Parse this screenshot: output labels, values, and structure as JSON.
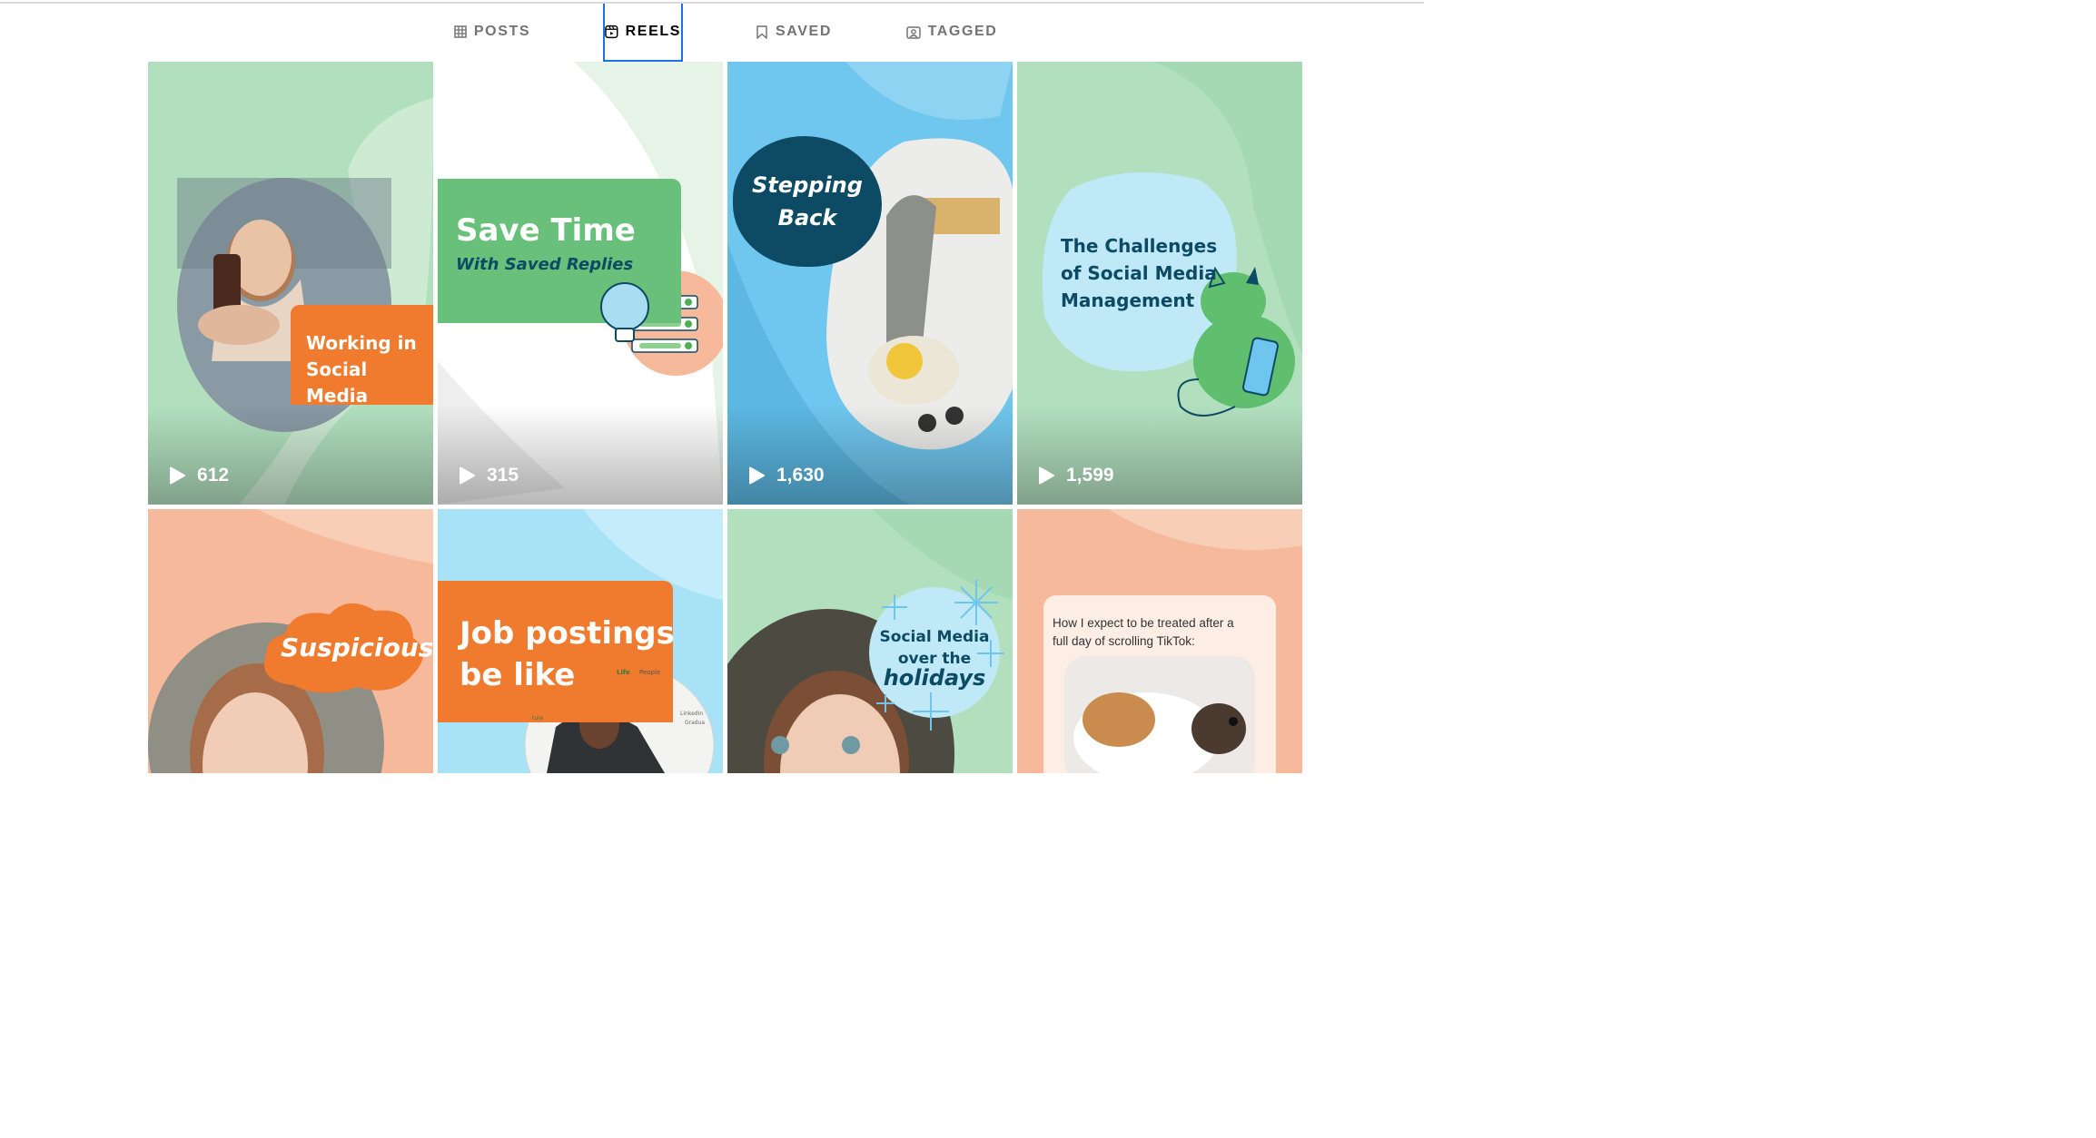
{
  "tabs": [
    {
      "label": "POSTS",
      "icon": "grid-icon"
    },
    {
      "label": "REELS",
      "icon": "reels-icon",
      "active": true
    },
    {
      "label": "SAVED",
      "icon": "bookmark-icon"
    },
    {
      "label": "TAGGED",
      "icon": "tagged-icon"
    }
  ],
  "reels": [
    {
      "title_line1": "Working in",
      "title_line2": "Social Media",
      "views": "612"
    },
    {
      "title": "Save Time",
      "subtitle": "With Saved Replies",
      "views": "315"
    },
    {
      "title_line1": "Stepping",
      "title_line2": "Back",
      "views": "1,630"
    },
    {
      "title_line1": "The Challenges",
      "title_line2": "of Social Media",
      "title_line3": "Management",
      "views": "1,599"
    },
    {
      "title": "Suspicious"
    },
    {
      "title_line1": "Job postings",
      "title_line2": "be like",
      "ui_text1": "Life",
      "ui_text2": "People",
      "ui_text3": "LinkedIn",
      "ui_text4": "Gradua",
      "ui_text5": "ture"
    },
    {
      "title_line1": "Social Media",
      "title_line2": "over the",
      "title_line3": "holidays"
    },
    {
      "caption_line1": "How I expect to be treated after a",
      "caption_line2": "full day of scrolling TikTok:"
    }
  ],
  "colors": {
    "active_tab_border": "#1a73e8",
    "green_bg": "#b2e0bf",
    "orange": "#f07a2e",
    "navy": "#0d4a63",
    "blue_bg": "#6fc6ee",
    "peach_bg": "#f6b99b"
  }
}
